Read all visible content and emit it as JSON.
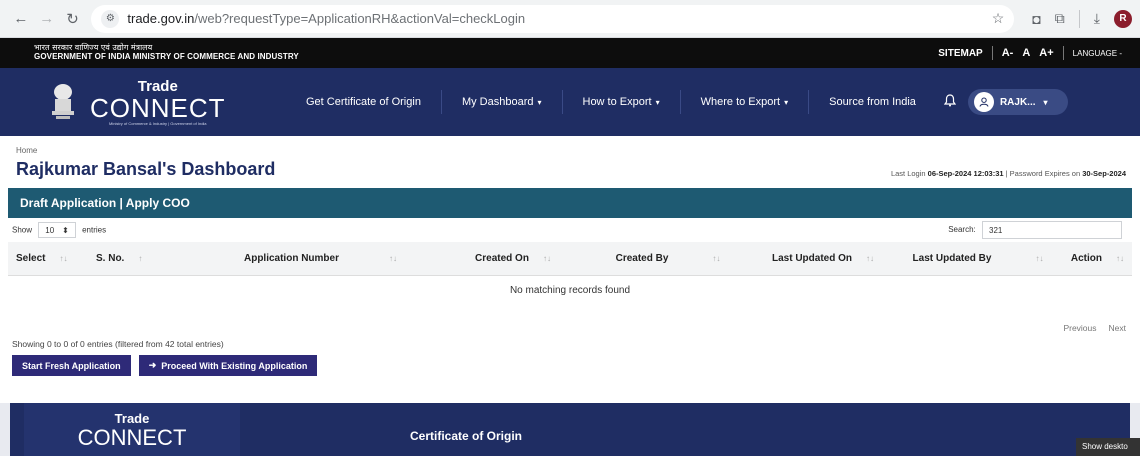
{
  "browser": {
    "url_host": "trade.gov.in",
    "url_path": "/web?requestType=ApplicationRH&actionVal=checkLogin",
    "profile_initial": "R"
  },
  "govbar": {
    "ministry_hindi": "भारत सरकार वाणिज्य एवं उद्योग मंत्रालय",
    "ministry_english": "GOVERNMENT OF INDIA MINISTRY OF COMMERCE AND INDUSTRY",
    "sitemap": "SITEMAP",
    "text_small": "A-",
    "text_normal": "A",
    "text_large": "A+",
    "language": "LANGUAGE -"
  },
  "nav": {
    "brand_top": "Trade",
    "brand_main": "CONNECT",
    "brand_sub": "Ministry of Commerce & Industry | Government of India",
    "items": [
      {
        "label": "Get Certificate of Origin",
        "caret": ""
      },
      {
        "label": "My Dashboard",
        "caret": "▾"
      },
      {
        "label": "How to Export",
        "caret": "▾"
      },
      {
        "label": "Where to Export",
        "caret": "▾"
      },
      {
        "label": "Source from India",
        "caret": ""
      }
    ],
    "user_label": "RAJK..."
  },
  "page": {
    "breadcrumb": "Home",
    "title": "Rajkumar Bansal's Dashboard",
    "last_login_label": "Last Login",
    "last_login_value": "06-Sep-2024 12:03:31",
    "password_label": " | Password Expires on ",
    "password_value": "30-Sep-2024"
  },
  "panel": {
    "heading": "Draft Application | Apply COO",
    "show_label": "Show",
    "entries_value": "10",
    "entries_label": "entries",
    "search_label": "Search:",
    "search_value": "321",
    "columns": [
      "Select",
      "S. No.",
      "Application Number",
      "Created On",
      "Created By",
      "Last Updated On",
      "Last Updated By",
      "Action"
    ],
    "empty_message": "No matching records found",
    "info": "Showing 0 to 0 of 0 entries (filtered from 42 total entries)",
    "prev": "Previous",
    "next": "Next",
    "btn_fresh": "Start Fresh Application",
    "btn_existing": "Proceed With Existing Application"
  },
  "footer": {
    "brand_top": "Trade",
    "brand_main": "CONNECT",
    "section_title": "Certificate of Origin",
    "toast": "Show deskto"
  }
}
